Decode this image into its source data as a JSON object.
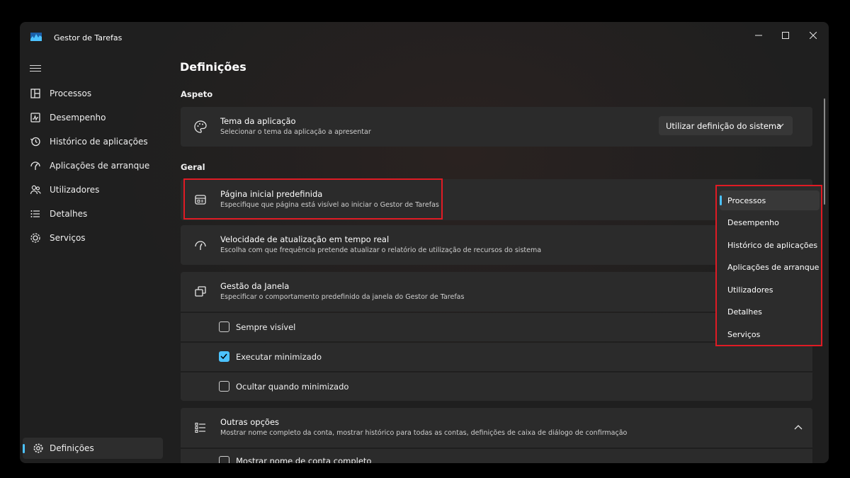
{
  "window": {
    "title": "Gestor de Tarefas"
  },
  "nav": {
    "items": [
      {
        "label": "Processos",
        "icon": "processes-icon"
      },
      {
        "label": "Desempenho",
        "icon": "performance-icon"
      },
      {
        "label": "Histórico de aplicações",
        "icon": "history-icon"
      },
      {
        "label": "Aplicações de arranque",
        "icon": "startup-icon"
      },
      {
        "label": "Utilizadores",
        "icon": "users-icon"
      },
      {
        "label": "Detalhes",
        "icon": "details-icon"
      },
      {
        "label": "Serviços",
        "icon": "services-icon"
      }
    ],
    "settings_label": "Definições"
  },
  "page": {
    "title": "Definições",
    "section_appearance": "Aspeto",
    "section_general": "Geral"
  },
  "theme": {
    "title": "Tema da aplicação",
    "subtitle": "Selecionar o tema da aplicação a apresentar",
    "value": "Utilizar definição do sistema"
  },
  "start_page": {
    "title": "Página inicial predefinida",
    "subtitle": "Especifique que página está visível ao iniciar o Gestor de Tarefas"
  },
  "update_speed": {
    "title": "Velocidade de atualização em tempo real",
    "subtitle": "Escolha com que frequência pretende atualizar o relatório de utilização de recursos do sistema"
  },
  "window_mgmt": {
    "title": "Gestão da Janela",
    "subtitle": "Especificar o comportamento predefinido da janela do Gestor de Tarefas",
    "options": [
      {
        "label": "Sempre visível",
        "checked": false
      },
      {
        "label": "Executar minimizado",
        "checked": true
      },
      {
        "label": "Ocultar quando minimizado",
        "checked": false
      }
    ]
  },
  "other": {
    "title": "Outras opções",
    "subtitle": "Mostrar nome completo da conta, mostrar histórico para todas as contas, definições de caixa de diálogo de confirmação",
    "partial_option": "Mostrar nome de conta completo"
  },
  "start_page_menu": {
    "items": [
      "Processos",
      "Desempenho",
      "Histórico de aplicações",
      "Aplicações de arranque",
      "Utilizadores",
      "Detalhes",
      "Serviços"
    ],
    "selected": "Processos"
  },
  "colors": {
    "accent": "#4cc2ff",
    "highlight": "#e01b24"
  }
}
